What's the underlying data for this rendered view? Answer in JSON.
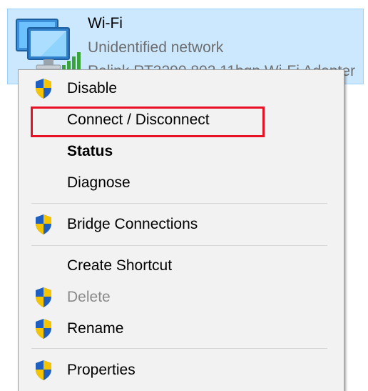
{
  "adapter": {
    "name": "Wi-Fi",
    "status": "Unidentified network",
    "device": "Ralink RT3290 802.11bgn Wi-Fi Adapter"
  },
  "menu": {
    "items": [
      {
        "label": "Disable",
        "shield": true,
        "enabled": true,
        "bold": false
      },
      {
        "label": "Connect / Disconnect",
        "shield": false,
        "enabled": true,
        "bold": false
      },
      {
        "label": "Status",
        "shield": false,
        "enabled": true,
        "bold": true
      },
      {
        "label": "Diagnose",
        "shield": false,
        "enabled": true,
        "bold": false
      },
      {
        "label": "Bridge Connections",
        "shield": true,
        "enabled": true,
        "bold": false
      },
      {
        "label": "Create Shortcut",
        "shield": false,
        "enabled": true,
        "bold": false
      },
      {
        "label": "Delete",
        "shield": true,
        "enabled": false,
        "bold": false
      },
      {
        "label": "Rename",
        "shield": true,
        "enabled": true,
        "bold": false
      },
      {
        "label": "Properties",
        "shield": true,
        "enabled": true,
        "bold": false
      }
    ]
  },
  "highlight": {
    "target": "Connect / Disconnect",
    "color": "#e81123"
  },
  "colors": {
    "selection_bg": "#cce8ff",
    "menu_bg": "#f2f2f2",
    "shield_blue": "#1f5fbf",
    "shield_yellow": "#f5c400"
  }
}
